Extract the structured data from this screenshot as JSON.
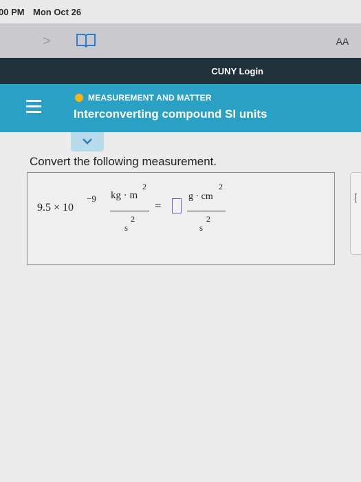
{
  "status_bar": {
    "time": "00 PM",
    "date": "Mon Oct 26"
  },
  "browser": {
    "text_size_button": "AA",
    "forward_icon": "chevron-right-icon",
    "reader_icon": "book-icon"
  },
  "header": {
    "login_label": "CUNY Login"
  },
  "topic": {
    "category": "MEASUREMENT AND MATTER",
    "title": "Interconverting compound SI units",
    "status_color": "#f7b418",
    "bar_color": "#2aa0c5"
  },
  "question": {
    "instruction": "Convert the following measurement.",
    "coefficient": "9.5 × 10",
    "exponent": "−9",
    "from_units": {
      "numerator": "kg · m",
      "numerator_exponent": "2",
      "denominator": "s",
      "denominator_exponent": "2"
    },
    "equals": "=",
    "to_units": {
      "numerator": "g · cm",
      "numerator_exponent": "2",
      "denominator": "s",
      "denominator_exponent": "2"
    },
    "answer_value": ""
  },
  "side_panel": {
    "glyph": "["
  }
}
